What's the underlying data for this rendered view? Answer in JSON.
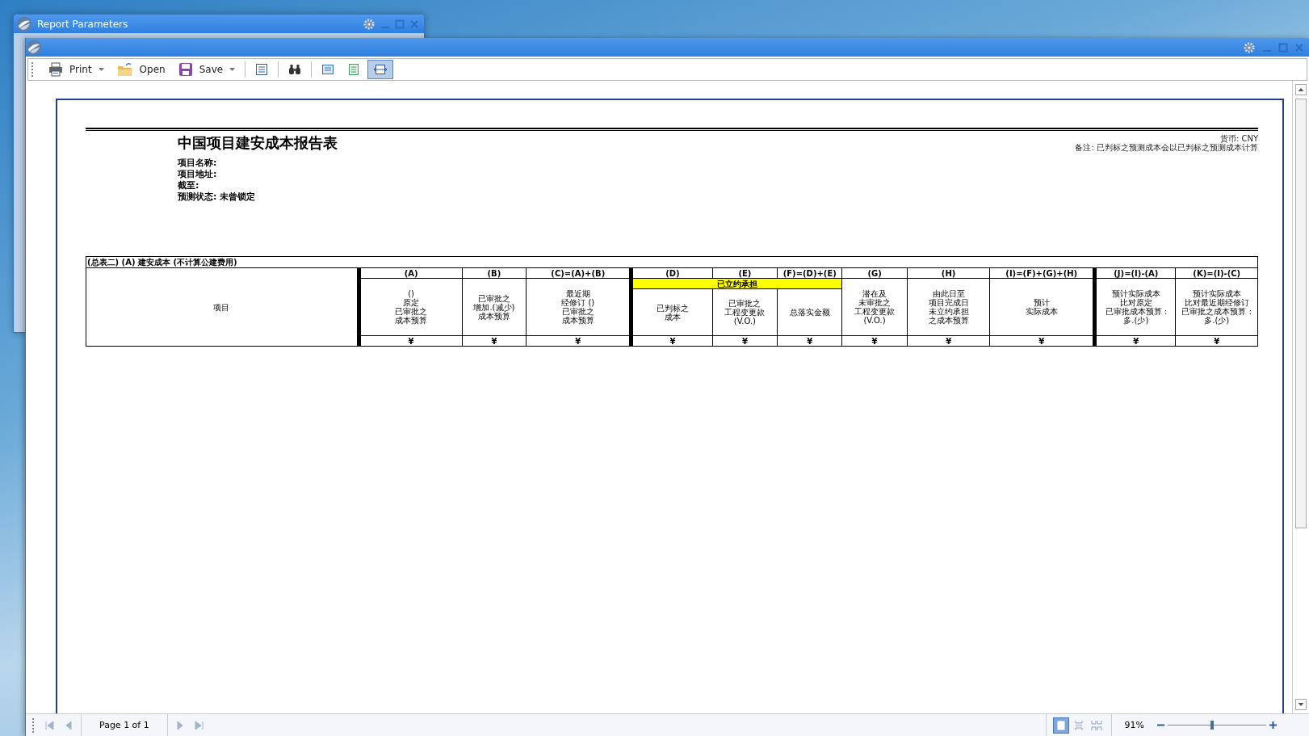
{
  "back_window": {
    "title": "Report Parameters"
  },
  "toolbar": [
    {
      "kind": "button",
      "label": "Print",
      "dropdown": true,
      "selected": false
    },
    {
      "kind": "button",
      "label": "Open",
      "dropdown": false,
      "selected": false
    },
    {
      "kind": "button",
      "label": "Save",
      "dropdown": true,
      "selected": false
    },
    {
      "kind": "separator"
    },
    {
      "kind": "icon",
      "selected": false
    },
    {
      "kind": "separator"
    },
    {
      "kind": "icon",
      "selected": false
    },
    {
      "kind": "separator"
    },
    {
      "kind": "icon",
      "selected": false
    },
    {
      "kind": "icon",
      "selected": false
    },
    {
      "kind": "icon",
      "selected": true
    }
  ],
  "report": {
    "title": "中国项目建安成本报告表",
    "info": [
      "项目名称:",
      "项目地址:",
      "截至:",
      "预测状态: 未曾锁定"
    ],
    "notes": [
      "货币: CNY",
      "备注: 已判标之预测成本会以已判标之预测成本计算"
    ],
    "table": {
      "caption": "(总表二) (A) 建安成本  (不计算公建费用)",
      "row_header": "项目",
      "sections": [
        {
          "items": [
            {
              "kind": "column",
              "code": "(A)",
              "heading": [
                "()",
                "原定",
                "已审批之",
                "成本预算"
              ],
              "cell": "¥"
            },
            {
              "kind": "column",
              "code": "(B)",
              "heading": [
                "已审批之",
                "增加.(减少)",
                "成本预算"
              ],
              "cell": "¥"
            },
            {
              "kind": "column",
              "code": "(C)=(A)+(B)",
              "heading": [
                "最近期",
                "经修订 ()",
                "已审批之",
                "成本预算"
              ],
              "cell": "¥"
            }
          ]
        },
        {
          "items": [
            {
              "kind": "group",
              "label": "已立约承担",
              "columns": [
                {
                  "code": "(D)",
                  "heading": [
                    "已判标之",
                    "成本"
                  ],
                  "cell": "¥"
                },
                {
                  "code": "(E)",
                  "heading": [
                    "已审批之",
                    "工程变更款",
                    "(V.O.)"
                  ],
                  "cell": "¥"
                },
                {
                  "code": "(F)=(D)+(E)",
                  "heading": [
                    "总落实金额"
                  ],
                  "cell": "¥"
                }
              ]
            },
            {
              "kind": "column",
              "code": "(G)",
              "heading": [
                "潜在及",
                "未审批之",
                "工程变更款",
                "(V.O.)"
              ],
              "cell": "¥"
            },
            {
              "kind": "column",
              "code": "(H)",
              "heading": [
                "由此日至",
                "项目完成日",
                "未立约承担",
                "之成本预算"
              ],
              "cell": "¥"
            },
            {
              "kind": "column",
              "code": "(I)=(F)+(G)+(H)",
              "heading": [
                "预计",
                "实际成本"
              ],
              "cell": "¥"
            }
          ]
        },
        {
          "items": [
            {
              "kind": "column",
              "code": "(J)=(I)-(A)",
              "heading": [
                "预计实际成本",
                "比对原定",
                "已审批成本预算 :",
                "多.(少)"
              ],
              "cell": "¥"
            },
            {
              "kind": "column",
              "code": "(K)=(I)-(C)",
              "heading": [
                "预计实际成本",
                "比对最近期经修订",
                "已审批之成本预算 :",
                "多.(少)"
              ],
              "cell": "¥"
            }
          ]
        }
      ]
    }
  },
  "pager": {
    "first_disabled": true,
    "prev_disabled": true,
    "page_label": "Page 1 of 1",
    "next_disabled": true,
    "last_disabled": true
  },
  "view_modes": [
    {
      "selected": true
    },
    {
      "selected": false
    },
    {
      "selected": false
    }
  ],
  "zoom": {
    "value": "91%",
    "level": 0.45
  }
}
